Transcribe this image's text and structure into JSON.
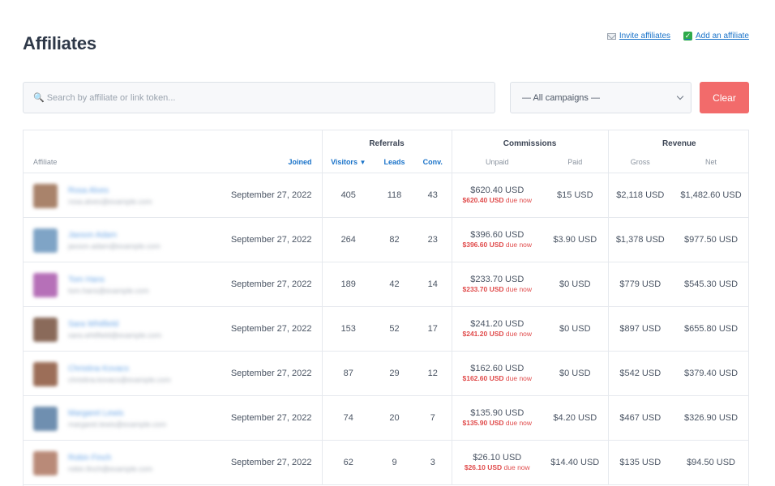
{
  "page": {
    "title": "Affiliates"
  },
  "actions": {
    "invite_label": "Invite affiliates",
    "add_label": "Add an affiliate"
  },
  "search": {
    "placeholder": "Search by affiliate or link token..."
  },
  "campaign_filter": {
    "selected": "— All campaigns —"
  },
  "clear_button": {
    "label": "Clear"
  },
  "table": {
    "groups": {
      "referrals": "Referrals",
      "commissions": "Commissions",
      "revenue": "Revenue"
    },
    "columns": {
      "affiliate": "Affiliate",
      "joined": "Joined",
      "visitors": "Visitors",
      "leads": "Leads",
      "conv": "Conv.",
      "unpaid": "Unpaid",
      "paid": "Paid",
      "gross": "Gross",
      "net": "Net"
    },
    "due_suffix": "due now",
    "rows": [
      {
        "name": "Rosa Alves",
        "email": "rosa.alves@example.com",
        "avatar_color": "#a9836b",
        "joined": "September 27, 2022",
        "visitors": "405",
        "leads": "118",
        "conv": "43",
        "unpaid": "$620.40 USD",
        "due": "$620.40 USD",
        "paid": "$15 USD",
        "gross": "$2,118 USD",
        "net": "$1,482.60 USD"
      },
      {
        "name": "Jaxson Adam",
        "email": "jaxson.adam@example.com",
        "avatar_color": "#7fa4c6",
        "joined": "September 27, 2022",
        "visitors": "264",
        "leads": "82",
        "conv": "23",
        "unpaid": "$396.60 USD",
        "due": "$396.60 USD",
        "paid": "$3.90 USD",
        "gross": "$1,378 USD",
        "net": "$977.50 USD"
      },
      {
        "name": "Tom Hans",
        "email": "tom.hans@example.com",
        "avatar_color": "#b670b8",
        "joined": "September 27, 2022",
        "visitors": "189",
        "leads": "42",
        "conv": "14",
        "unpaid": "$233.70 USD",
        "due": "$233.70 USD",
        "paid": "$0 USD",
        "gross": "$779 USD",
        "net": "$545.30 USD"
      },
      {
        "name": "Sara Whitfield",
        "email": "sara.whitfield@example.com",
        "avatar_color": "#8a6a5a",
        "joined": "September 27, 2022",
        "visitors": "153",
        "leads": "52",
        "conv": "17",
        "unpaid": "$241.20 USD",
        "due": "$241.20 USD",
        "paid": "$0 USD",
        "gross": "$897 USD",
        "net": "$655.80 USD"
      },
      {
        "name": "Christina Kovacs",
        "email": "christina.kovacs@example.com",
        "avatar_color": "#9c6e58",
        "joined": "September 27, 2022",
        "visitors": "87",
        "leads": "29",
        "conv": "12",
        "unpaid": "$162.60 USD",
        "due": "$162.60 USD",
        "paid": "$0 USD",
        "gross": "$542 USD",
        "net": "$379.40 USD"
      },
      {
        "name": "Margaret Lewis",
        "email": "margaret.lewis@example.com",
        "avatar_color": "#6f8fb0",
        "joined": "September 27, 2022",
        "visitors": "74",
        "leads": "20",
        "conv": "7",
        "unpaid": "$135.90 USD",
        "due": "$135.90 USD",
        "paid": "$4.20 USD",
        "gross": "$467 USD",
        "net": "$326.90 USD"
      },
      {
        "name": "Robin Finch",
        "email": "robin.finch@example.com",
        "avatar_color": "#b98a78",
        "joined": "September 27, 2022",
        "visitors": "62",
        "leads": "9",
        "conv": "3",
        "unpaid": "$26.10 USD",
        "due": "$26.10 USD",
        "paid": "$14.40 USD",
        "gross": "$135 USD",
        "net": "$94.50 USD"
      }
    ]
  }
}
